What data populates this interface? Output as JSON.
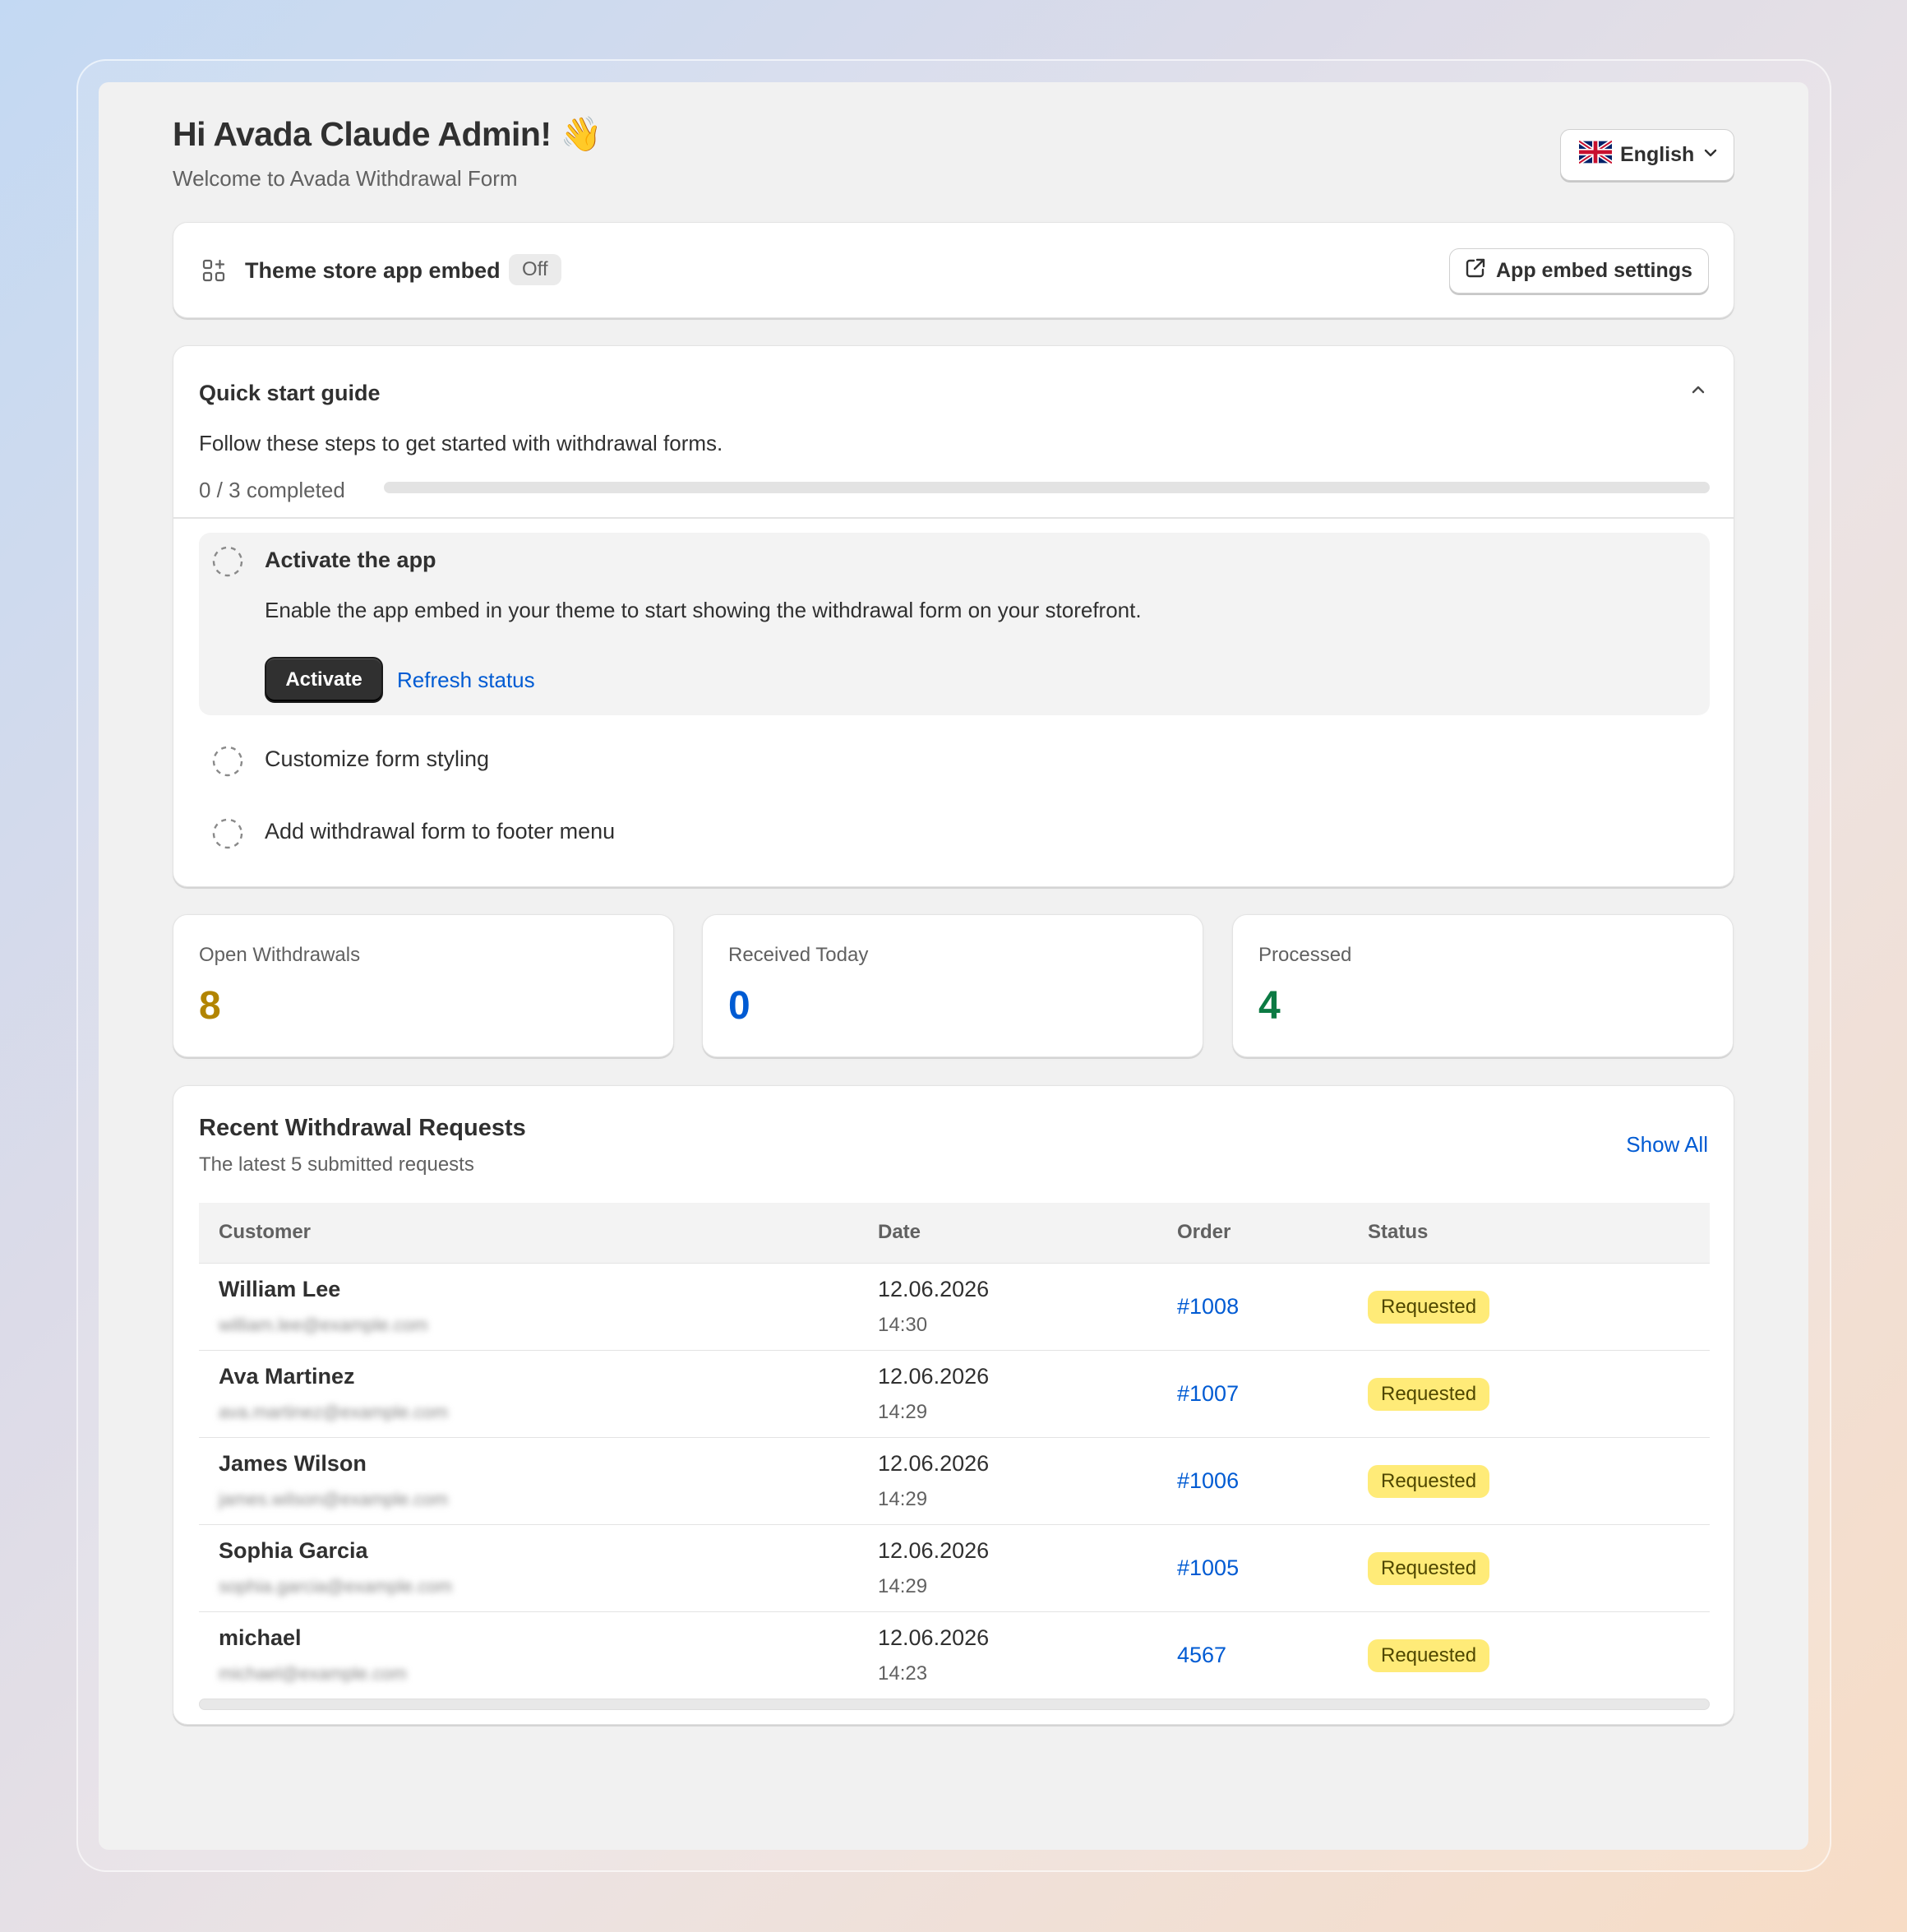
{
  "header": {
    "greeting": "Hi Avada Claude Admin! 👋",
    "subtitle": "Welcome to Avada Withdrawal Form",
    "language": "English",
    "language_icon": "uk-flag-icon"
  },
  "embed": {
    "label": "Theme store app embed",
    "status": "Off",
    "settings_button": "App embed settings"
  },
  "guide": {
    "title": "Quick start guide",
    "description": "Follow these steps to get started with withdrawal forms.",
    "progress_text": "0 / 3 completed",
    "progress_fraction": 0,
    "steps": [
      {
        "title": "Activate the app",
        "description": "Enable the app embed in your theme to start showing the withdrawal form on your storefront.",
        "primary_action": "Activate",
        "secondary_action": "Refresh status"
      },
      {
        "title": "Customize form styling"
      },
      {
        "title": "Add withdrawal form to footer menu"
      }
    ]
  },
  "stats": [
    {
      "label": "Open Withdrawals",
      "value": "8",
      "color": "#b28400"
    },
    {
      "label": "Received Today",
      "value": "0",
      "color": "#005bd3"
    },
    {
      "label": "Processed",
      "value": "4",
      "color": "#0c7a43"
    }
  ],
  "recent": {
    "title": "Recent Withdrawal Requests",
    "subtitle": "The latest 5 submitted requests",
    "show_all": "Show All",
    "columns": [
      "Customer",
      "Date",
      "Order",
      "Status"
    ],
    "rows": [
      {
        "name": "William Lee",
        "email": "william.lee@example.com",
        "date": "12.06.2026",
        "time": "14:30",
        "order": "#1008",
        "status": "Requested"
      },
      {
        "name": "Ava Martinez",
        "email": "ava.martinez@example.com",
        "date": "12.06.2026",
        "time": "14:29",
        "order": "#1007",
        "status": "Requested"
      },
      {
        "name": "James Wilson",
        "email": "james.wilson@example.com",
        "date": "12.06.2026",
        "time": "14:29",
        "order": "#1006",
        "status": "Requested"
      },
      {
        "name": "Sophia Garcia",
        "email": "sophia.garcia@example.com",
        "date": "12.06.2026",
        "time": "14:29",
        "order": "#1005",
        "status": "Requested"
      },
      {
        "name": "michael",
        "email": "michael@example.com",
        "date": "12.06.2026",
        "time": "14:23",
        "order": "4567",
        "status": "Requested"
      }
    ]
  }
}
